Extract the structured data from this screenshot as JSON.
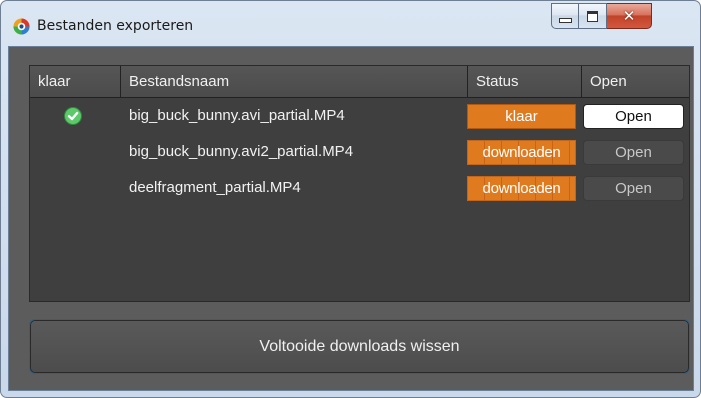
{
  "window": {
    "title": "Bestanden exporteren",
    "close_glyph": "✕"
  },
  "table": {
    "headers": [
      "klaar",
      "Bestandsnaam",
      "Status",
      "Open"
    ],
    "rows": [
      {
        "done_icon": "check-icon",
        "filename": "big_buck_bunny.avi_partial.MP4",
        "status": "klaar",
        "open_label": "Open",
        "open_enabled": true
      },
      {
        "done_icon": "",
        "filename": "big_buck_bunny.avi2_partial.MP4",
        "status": "downloaden",
        "open_label": "Open",
        "open_enabled": false
      },
      {
        "done_icon": "",
        "filename": "deelfragment_partial.MP4",
        "status": "downloaden",
        "open_label": "Open",
        "open_enabled": false
      }
    ]
  },
  "footer": {
    "clear_label": "Voltooide downloads wissen"
  },
  "colors": {
    "accent": "#e07a1e",
    "check": "#5cc96a",
    "panel": "#5c5c5c"
  }
}
